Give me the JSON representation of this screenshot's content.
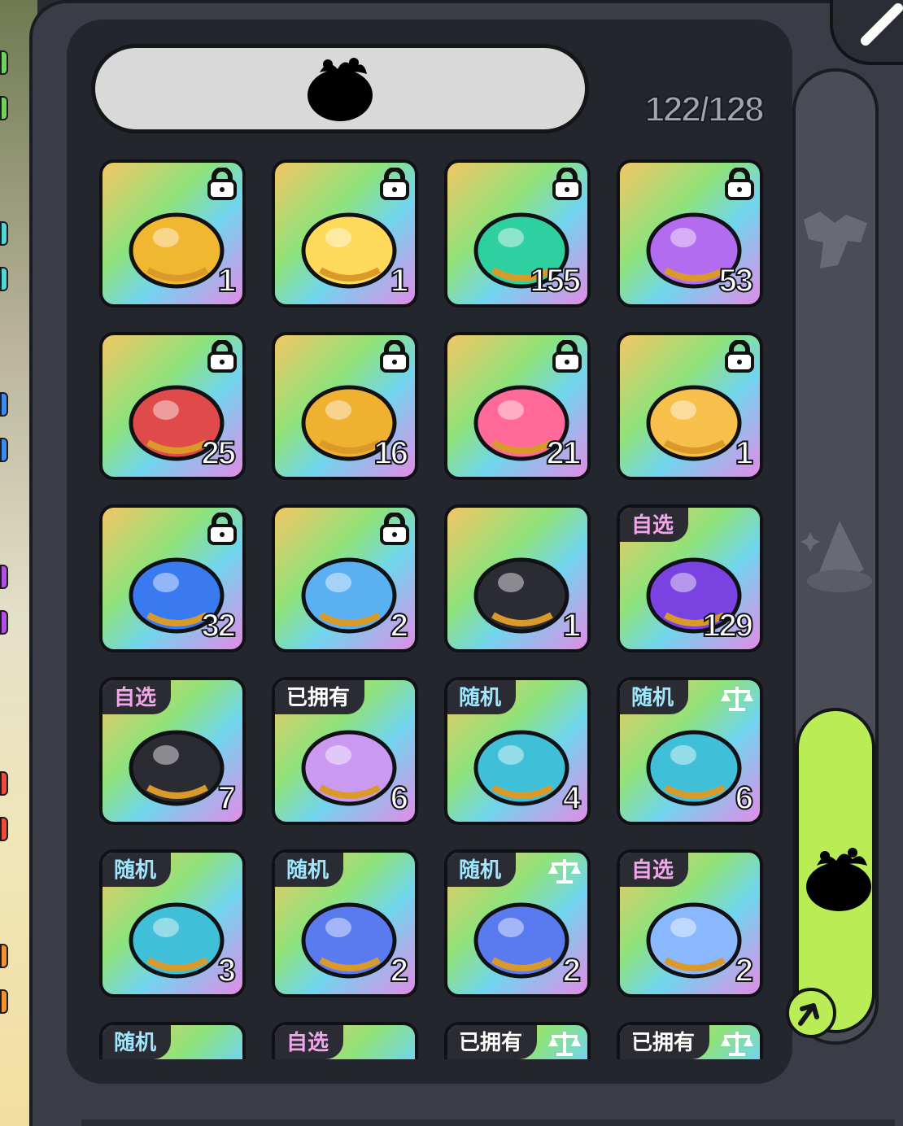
{
  "header": {
    "inventory_count": "122/128"
  },
  "colors": {
    "locked_card_gradient": [
      "#f3c665",
      "#8fe27a",
      "#71d5ee",
      "#e28be6"
    ],
    "active_tab": "#b9ec55",
    "tag_pick": "#f0a6e8",
    "tag_random": "#9fe6ff"
  },
  "items": [
    {
      "icon": "golden-egg-icon",
      "qty": "1",
      "locked": true,
      "tag": ""
    },
    {
      "icon": "armor-chest-icon",
      "qty": "1",
      "locked": true,
      "tag": ""
    },
    {
      "icon": "star-hammer-icon",
      "qty": "155",
      "locked": true,
      "tag": ""
    },
    {
      "icon": "purple-drop-gem-icon",
      "qty": "53",
      "locked": true,
      "tag": ""
    },
    {
      "icon": "red-drop-gem-icon",
      "qty": "25",
      "locked": true,
      "tag": ""
    },
    {
      "icon": "gold-hammer-icon",
      "qty": "16",
      "locked": true,
      "tag": ""
    },
    {
      "icon": "winged-potion-icon",
      "qty": "21",
      "locked": true,
      "tag": ""
    },
    {
      "icon": "magic-scroll-icon",
      "qty": "1",
      "locked": true,
      "tag": ""
    },
    {
      "icon": "star-orb-icon",
      "qty": "32",
      "locked": true,
      "tag": ""
    },
    {
      "icon": "hourglass-icon",
      "qty": "2",
      "locked": true,
      "tag": ""
    },
    {
      "icon": "yin-yang-card-icon",
      "qty": "1",
      "locked": false,
      "tag": ""
    },
    {
      "icon": "purple-chest-icon",
      "qty": "129",
      "locked": false,
      "tag": "自选"
    },
    {
      "icon": "puzzle-piece-icon",
      "qty": "7",
      "locked": false,
      "tag": "自选"
    },
    {
      "icon": "mystery-shirt-icon",
      "qty": "6",
      "locked": false,
      "tag": "已拥有"
    },
    {
      "icon": "treasure-chest-icon",
      "qty": "4",
      "locked": false,
      "tag": "随机"
    },
    {
      "icon": "treasure-chest-icon",
      "qty": "6",
      "locked": false,
      "tag": "随机",
      "scale": true
    },
    {
      "icon": "treasure-chest-icon",
      "qty": "3",
      "locked": false,
      "tag": "随机"
    },
    {
      "icon": "gem-chest-icon",
      "qty": "2",
      "locked": false,
      "tag": "随机"
    },
    {
      "icon": "gem-chest-icon",
      "qty": "2",
      "locked": false,
      "tag": "随机",
      "scale": true
    },
    {
      "icon": "s1-orb-icon",
      "qty": "2",
      "locked": false,
      "tag": "自选"
    },
    {
      "icon": "",
      "qty": "",
      "locked": false,
      "tag": "随机"
    },
    {
      "icon": "",
      "qty": "",
      "locked": false,
      "tag": "自选"
    },
    {
      "icon": "",
      "qty": "",
      "locked": false,
      "tag": "已拥有",
      "scale": true
    },
    {
      "icon": "",
      "qty": "",
      "locked": false,
      "tag": "已拥有",
      "scale": true
    }
  ],
  "side_tabs": [
    {
      "icon": "costume-icon",
      "active": false
    },
    {
      "icon": "crystal-icon",
      "active": false
    },
    {
      "icon": "fruit-bag-icon",
      "active": true
    }
  ]
}
